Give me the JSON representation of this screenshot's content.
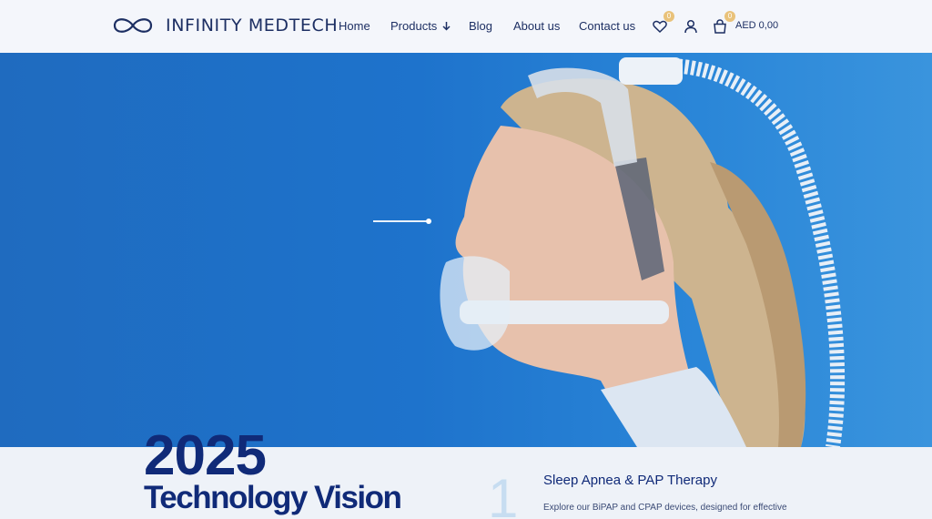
{
  "brand": {
    "name": "INFINITY MEDTECH",
    "logo_icon": "infinity-icon"
  },
  "nav": {
    "items": [
      {
        "label": "Home"
      },
      {
        "label": "Products"
      },
      {
        "label": "Blog"
      },
      {
        "label": "About us"
      },
      {
        "label": "Contact us"
      }
    ]
  },
  "header_icons": {
    "wishlist_icon": "heart-icon",
    "account_icon": "user-icon",
    "cart_icon": "shopping-bag-icon",
    "wishlist_count": "0",
    "cart_count": "0",
    "cart_total": "AED 0,00",
    "badge_color": "#e9c27a"
  },
  "hero": {
    "background_color": "#1e73cc"
  },
  "feature": {
    "year": "2025",
    "heading": "Technology Vision",
    "number": "1",
    "service_title": "Sleep Apnea & PAP Therapy",
    "service_desc": "Explore our BiPAP and CPAP devices, designed for effective"
  }
}
